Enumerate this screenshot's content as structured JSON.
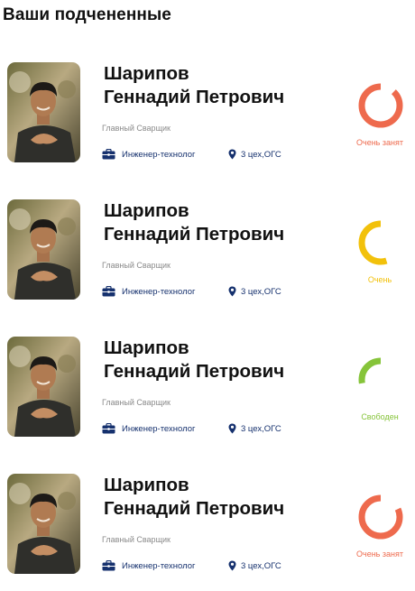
{
  "header": {
    "title": "Ваши подчененные"
  },
  "subordinates": [
    {
      "name_line1": "Шарипов",
      "name_line2": "Геннадий Петрович",
      "role": "Главный Сварщик",
      "position": "Инженер-технолог",
      "department": "3 цех,ОГС",
      "status": "Очень занят",
      "status_color": "#ee6a4d",
      "load": 0.88
    },
    {
      "name_line1": "Шарипов",
      "name_line2": "Геннадий Петрович",
      "role": "Главный Сварщик",
      "position": "Инженер-технолог",
      "department": "3 цех,ОГС",
      "status": "Очень",
      "status_color": "#f2c10b",
      "load": 0.55
    },
    {
      "name_line1": "Шарипов",
      "name_line2": "Геннадий Петрович",
      "role": "Главный Сварщик",
      "position": "Инженер-технолог",
      "department": "3 цех,ОГС",
      "status": "Свободен",
      "status_color": "#86c43a",
      "load": 0.28
    },
    {
      "name_line1": "Шарипов",
      "name_line2": "Геннадий Петрович",
      "role": "Главный Сварщик",
      "position": "Инженер-технолог",
      "department": "3 цех,ОГС",
      "status": "Очень занят",
      "status_color": "#ee6a4d",
      "load": 0.82
    }
  ]
}
